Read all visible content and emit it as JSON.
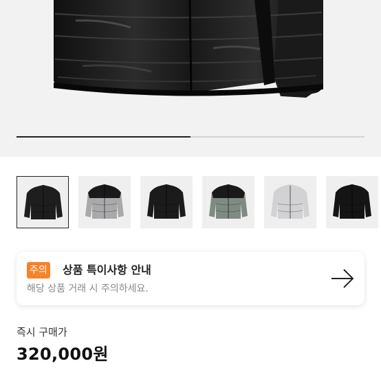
{
  "gallery": {
    "progress_fraction": 0.5,
    "thumbnails": [
      {
        "name": "black-glossy",
        "body": "#1e1e1e",
        "shoulder": "#1e1e1e",
        "selected": true
      },
      {
        "name": "grey-black-yoke",
        "body": "#a9a9ab",
        "shoulder": "#1a1a1a",
        "selected": false
      },
      {
        "name": "black",
        "body": "#1b1b1b",
        "shoulder": "#1b1b1b",
        "selected": false
      },
      {
        "name": "green-black-yoke",
        "body": "#7f8b82",
        "shoulder": "#1a1a1a",
        "selected": false
      },
      {
        "name": "silver",
        "body": "#d2d2d4",
        "shoulder": "#d2d2d4",
        "selected": false
      },
      {
        "name": "black-matte",
        "body": "#151515",
        "shoulder": "#151515",
        "selected": false
      }
    ]
  },
  "notice": {
    "badge": "주의",
    "title": "상품 특이사항 안내",
    "subtitle": "해당 상품 거래 시 주의하세요.",
    "arrow_icon": "arrow-right-icon"
  },
  "purchase": {
    "label": "즉시 구매가",
    "price": "320,000원"
  }
}
